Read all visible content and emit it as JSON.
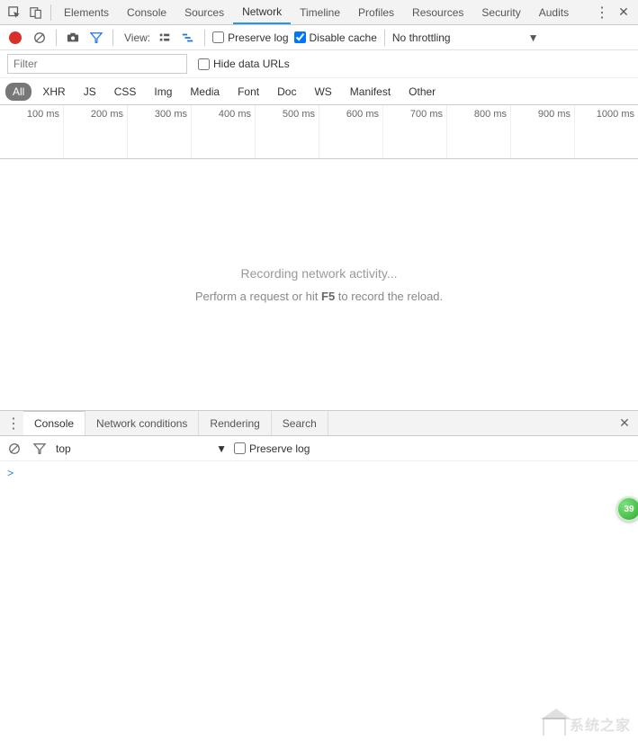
{
  "tabs": {
    "main": [
      "Elements",
      "Console",
      "Sources",
      "Network",
      "Timeline",
      "Profiles",
      "Resources",
      "Security",
      "Audits"
    ],
    "active": 3
  },
  "nettool": {
    "view_label": "View:",
    "preserve_log": "Preserve log",
    "disable_cache": "Disable cache",
    "throttling": "No throttling"
  },
  "filter": {
    "placeholder": "Filter",
    "hide_data_urls": "Hide data URLs"
  },
  "types": [
    "All",
    "XHR",
    "JS",
    "CSS",
    "Img",
    "Media",
    "Font",
    "Doc",
    "WS",
    "Manifest",
    "Other"
  ],
  "types_active": 0,
  "timeline_ticks": [
    "100 ms",
    "200 ms",
    "300 ms",
    "400 ms",
    "500 ms",
    "600 ms",
    "700 ms",
    "800 ms",
    "900 ms",
    "1000 ms"
  ],
  "empty": {
    "line1": "Recording network activity...",
    "line2_pre": "Perform a request or hit ",
    "line2_key": "F5",
    "line2_post": " to record the reload."
  },
  "drawer": {
    "tabs": [
      "Console",
      "Network conditions",
      "Rendering",
      "Search"
    ],
    "active": 0
  },
  "console": {
    "context": "top",
    "preserve_log": "Preserve log",
    "prompt": ">"
  },
  "badge": "39",
  "watermark": "系统之家"
}
